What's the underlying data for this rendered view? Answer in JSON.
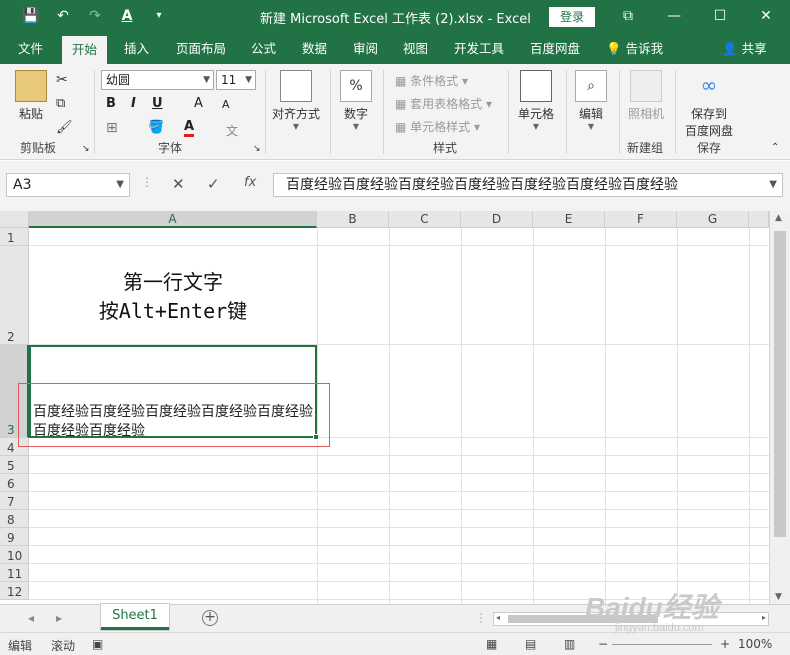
{
  "window": {
    "title": "新建 Microsoft Excel 工作表 (2).xlsx  -  Excel",
    "login": "登录",
    "qat": {
      "save_icon": "💾",
      "undo_icon": "↶",
      "redo_icon": "↷",
      "font_color_icon": "A",
      "more_icon": "▾"
    },
    "controls": {
      "ribbon_display": "⧉",
      "minimize": "—",
      "maximize": "☐",
      "close": "✕"
    }
  },
  "tabs": [
    "文件",
    "开始",
    "插入",
    "页面布局",
    "公式",
    "数据",
    "审阅",
    "视图",
    "开发工具",
    "百度网盘",
    "告诉我",
    "共享"
  ],
  "active_tab": "开始",
  "ribbon": {
    "clipboard": {
      "paste": "粘贴",
      "label": "剪贴板"
    },
    "font": {
      "name": "幼圆",
      "size": "11",
      "bold": "B",
      "italic": "I",
      "underline": "U",
      "grow": "A",
      "shrink": "A",
      "font_color": "A",
      "phonetic": "文",
      "label": "字体"
    },
    "alignment": {
      "label": "对齐方式"
    },
    "number": {
      "label": "数字"
    },
    "styles": {
      "conditional": "条件格式",
      "table": "套用表格格式",
      "cell_style": "单元格样式",
      "label": "样式"
    },
    "cells": {
      "label": "单元格"
    },
    "editing": {
      "label": "编辑"
    },
    "camera": {
      "label": "照相机",
      "group": "新建组"
    },
    "save_baidu": {
      "line1": "保存到",
      "line2": "百度网盘",
      "group": "保存"
    }
  },
  "formula_bar": {
    "name_box": "A3",
    "cancel": "✕",
    "enter": "✓",
    "fx": "fx",
    "content": "百度经验百度经验百度经验百度经验百度经验百度经验百度经验"
  },
  "columns": [
    "A",
    "B",
    "C",
    "D",
    "E",
    "F",
    "G"
  ],
  "rows": [
    "1",
    "2",
    "3",
    "4",
    "5",
    "6",
    "7",
    "8",
    "9",
    "10",
    "11",
    "12"
  ],
  "cells": {
    "A2_line1": "第一行文字",
    "A2_line2": "按Alt+Enter键",
    "A3": "百度经验百度经验百度经验百度经验百度经验百度经验百度经验"
  },
  "sheets": [
    "Sheet1"
  ],
  "status": {
    "mode": "编辑",
    "scroll": "滚动",
    "zoom": "100%",
    "zoom_out": "−",
    "zoom_in": "+"
  },
  "watermark": {
    "brand": "Baidu经验",
    "url": "jingyan.baidu.com"
  }
}
